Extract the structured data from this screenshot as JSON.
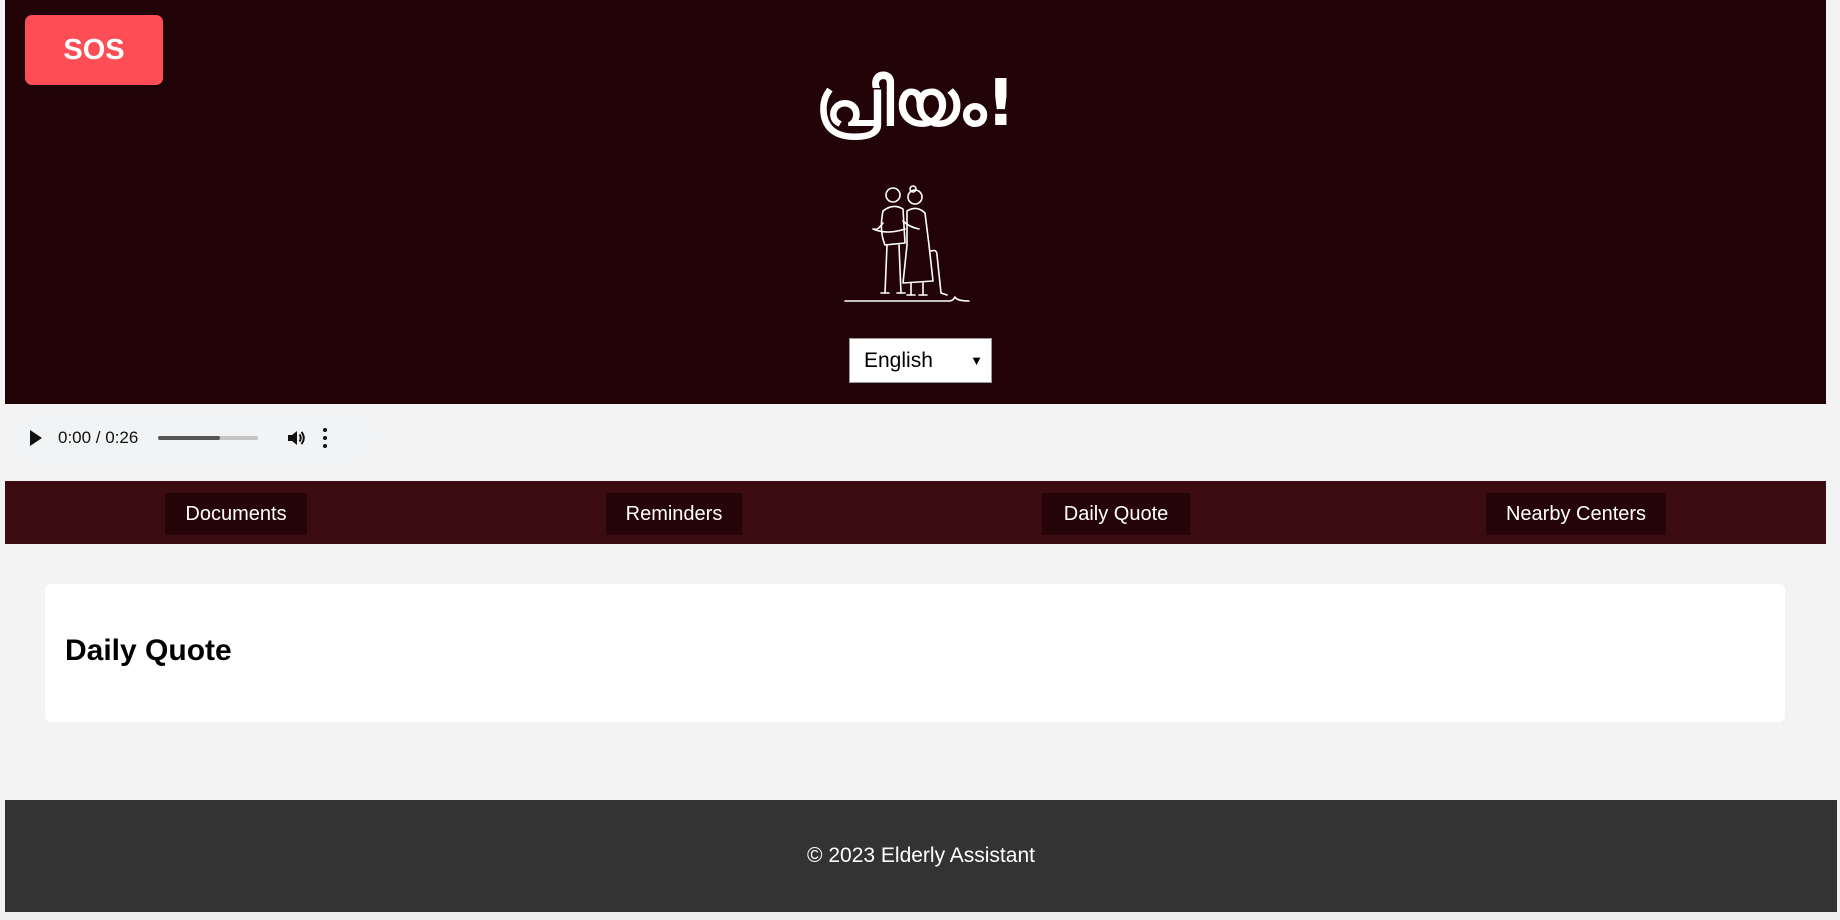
{
  "header": {
    "sos_label": "SOS",
    "title": "പ്രിയം!",
    "illustration_icon": "elderly-couple-icon",
    "language_selected": "English"
  },
  "audio": {
    "time": "0:00 / 0:26",
    "progress": 0.62
  },
  "nav": {
    "items": [
      {
        "label": "Documents"
      },
      {
        "label": "Reminders"
      },
      {
        "label": "Daily Quote"
      },
      {
        "label": "Nearby Centers"
      }
    ]
  },
  "card": {
    "heading": "Daily Quote"
  },
  "footer": {
    "text": "© 2023 Elderly Assistant"
  },
  "colors": {
    "header_bg": "#220408",
    "sos_bg": "#ff4d55",
    "nav_bg": "#3c0d10",
    "nav_item_bg": "#250507",
    "footer_bg": "#333333"
  }
}
